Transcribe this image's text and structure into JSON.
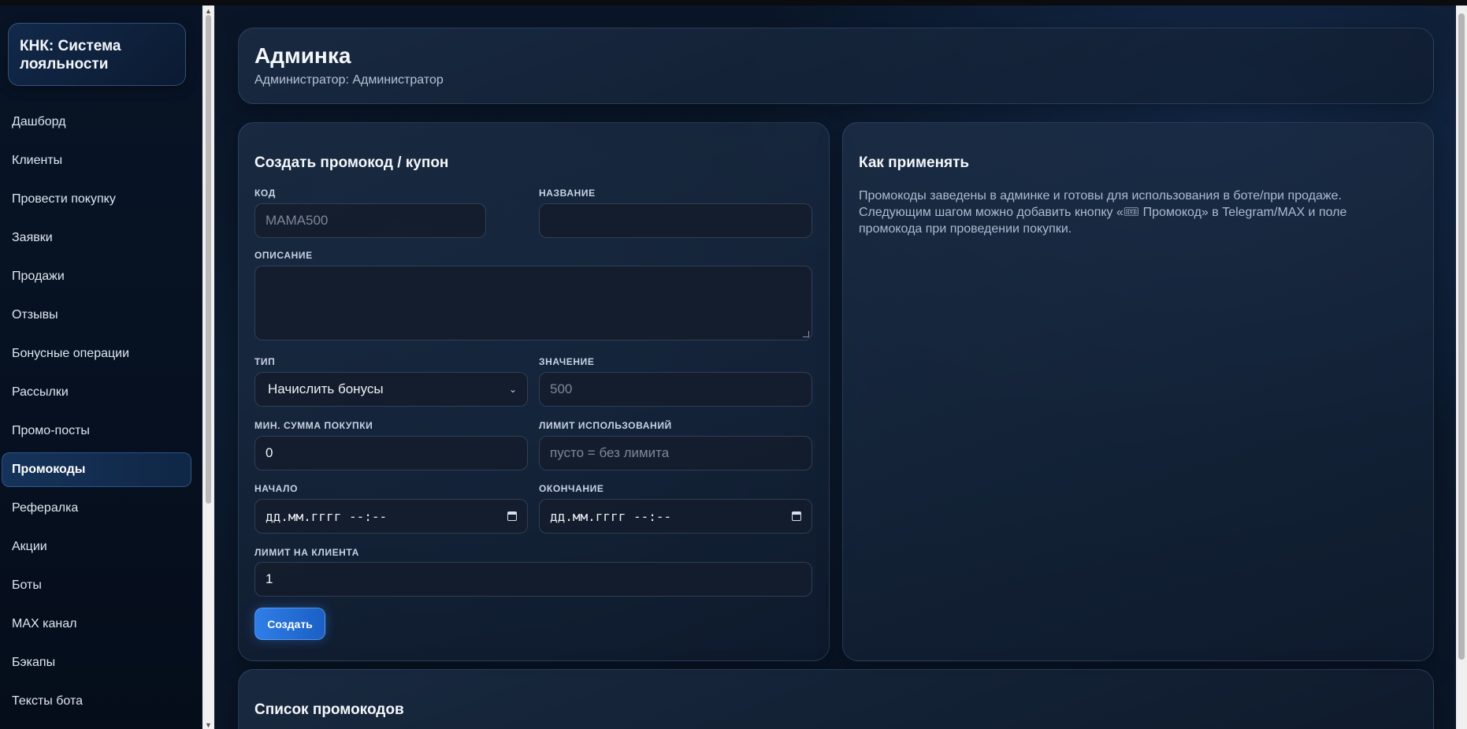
{
  "brand": {
    "title": "КНК: Система лояльности"
  },
  "sidebar": {
    "items": [
      {
        "label": "Дашборд"
      },
      {
        "label": "Клиенты"
      },
      {
        "label": "Провести покупку"
      },
      {
        "label": "Заявки"
      },
      {
        "label": "Продажи"
      },
      {
        "label": "Отзывы"
      },
      {
        "label": "Бонусные операции"
      },
      {
        "label": "Рассылки"
      },
      {
        "label": "Промо-посты"
      },
      {
        "label": "Промокоды",
        "active": true
      },
      {
        "label": "Рефералка"
      },
      {
        "label": "Акции"
      },
      {
        "label": "Боты"
      },
      {
        "label": "MAX канал"
      },
      {
        "label": "Бэкапы"
      },
      {
        "label": "Тексты бота"
      }
    ]
  },
  "header": {
    "title": "Админка",
    "subtitle": "Администратор: Администратор"
  },
  "form": {
    "title": "Создать промокод / купон",
    "code": {
      "label": "Код",
      "placeholder": "MAMA500",
      "value": ""
    },
    "name": {
      "label": "Название",
      "value": ""
    },
    "description": {
      "label": "Описание",
      "value": ""
    },
    "type": {
      "label": "Тип",
      "selected": "Начислить бонусы"
    },
    "amount": {
      "label": "Значение",
      "placeholder": "500",
      "value": ""
    },
    "min_purchase": {
      "label": "Мин. сумма покупки",
      "value": "0"
    },
    "usage_limit": {
      "label": "Лимит использований",
      "placeholder": "пусто = без лимита",
      "value": ""
    },
    "start": {
      "label": "Начало",
      "value": "дд.мм.гггг --:--"
    },
    "end": {
      "label": "Окончание",
      "value": "дд.мм.гггг --:--"
    },
    "client_limit": {
      "label": "Лимит на клиента",
      "value": "1"
    },
    "submit_label": "Создать"
  },
  "info": {
    "title": "Как применять",
    "text": "Промокоды заведены в админке и готовы для использования в боте/при продаже. Следующим шагом можно добавить кнопку «🎟 Промокод» в Telegram/MAX и поле промокода при проведении покупки."
  },
  "list": {
    "title": "Список промокодов"
  },
  "colors": {
    "accent": "#2f7ee8",
    "background": "#0a1628",
    "sidebar": "#081426"
  }
}
